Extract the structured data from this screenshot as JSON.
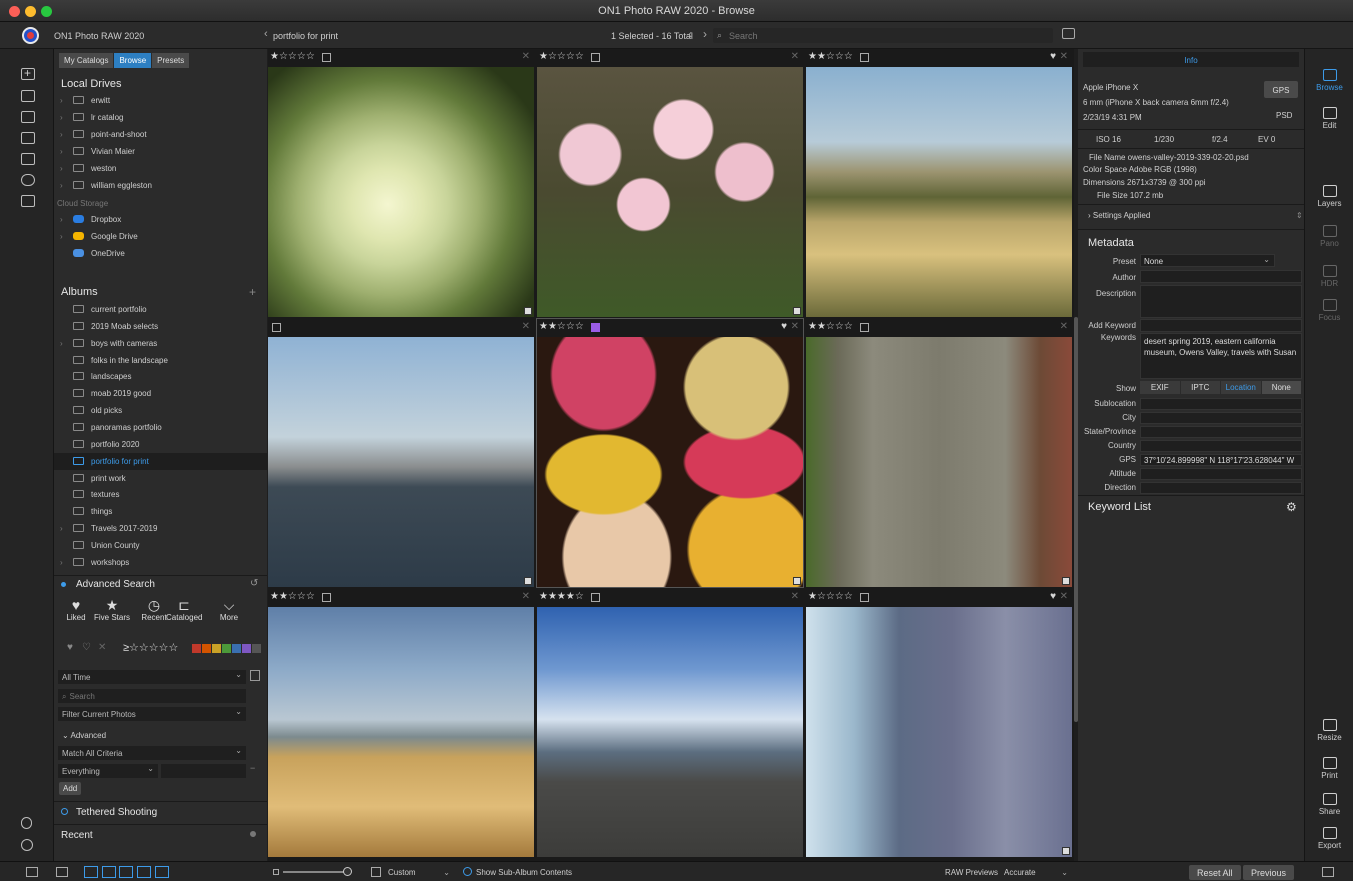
{
  "window": {
    "title": "ON1 Photo RAW 2020 - Browse"
  },
  "appbar": {
    "app_name": "ON1 Photo RAW 2020",
    "breadcrumb": "portfolio for print",
    "selection_info": "1 Selected - 16 Total",
    "search_placeholder": "Search"
  },
  "leftpanel": {
    "tabs": [
      "My Catalogs",
      "Browse",
      "Presets"
    ],
    "active_tab": "Browse",
    "local_drives_title": "Local Drives",
    "local_drives": [
      "erwitt",
      "lr catalog",
      "point-and-shoot",
      "Vivian Maier",
      "weston",
      "william eggleston"
    ],
    "cloud_title": "Cloud Storage",
    "cloud": [
      "Dropbox",
      "Google Drive",
      "OneDrive"
    ],
    "albums_title": "Albums",
    "albums": [
      "current portfolio",
      "2019 Moab selects",
      "boys with cameras",
      "folks in the landscape",
      "landscapes",
      "moab 2019 good",
      "old picks",
      "panoramas portfolio",
      "portfolio 2020",
      "portfolio for print",
      "print work",
      "textures",
      "things",
      "Travels 2017-2019",
      "Union County",
      "workshops"
    ],
    "selected_album": "portfolio for print",
    "advanced_search_title": "Advanced Search",
    "quick_filters": [
      "Liked",
      "Five Stars",
      "Recent",
      "Cataloged",
      "More"
    ],
    "time_filter": "All Time",
    "search_placeholder": "Search",
    "filter_scope": "Filter Current Photos",
    "advanced_label": "Advanced",
    "criteria": "Match All Criteria",
    "everything": "Everything",
    "add_label": "Add",
    "tethered_title": "Tethered Shooting",
    "recent_title": "Recent",
    "label_colors": [
      "#c0392b",
      "#d35400",
      "#c9a227",
      "#4c9a3a",
      "#3a6fb0",
      "#7e57c2",
      "#555555"
    ]
  },
  "grid": {
    "cells": [
      {
        "stars": "★☆☆☆☆",
        "subject": "white chrysanthemum",
        "liked": false
      },
      {
        "stars": "★☆☆☆☆",
        "subject": "pink tulips",
        "liked": false
      },
      {
        "stars": "★★☆☆☆",
        "subject": "grass field and hills",
        "liked": true
      },
      {
        "stars": "",
        "subject": "steel truss bridge",
        "liked": false
      },
      {
        "stars": "★★☆☆☆",
        "subject": "macarons",
        "liked": true
      },
      {
        "stars": "★★☆☆☆",
        "subject": "old wooden doors",
        "liked": false
      },
      {
        "stars": "★★☆☆☆",
        "subject": "irrigation wheel in wheat",
        "liked": false
      },
      {
        "stars": "★★★★☆",
        "subject": "highway and clouds",
        "liked": false
      },
      {
        "stars": "★☆☆☆☆",
        "subject": "cafe interior",
        "liked": true
      }
    ]
  },
  "info": {
    "header": "Info",
    "camera": "Apple iPhone X",
    "lens": "6 mm (iPhone X back camera 6mm f/2.4)",
    "date": "2/23/19 4:31 PM",
    "gps_button": "GPS",
    "format": "PSD",
    "iso": "ISO 16",
    "shutter": "1/230",
    "aperture": "f/2.4",
    "ev": "EV 0",
    "file_name": "File Name owens-valley-2019-339-02-20.psd",
    "color_space": "Color Space Adobe RGB (1998)",
    "dimensions": "Dimensions 2671x3739 @ 300 ppi",
    "file_size": "File Size 107.2 mb",
    "settings_applied": "Settings Applied"
  },
  "metadata": {
    "title": "Metadata",
    "preset_label": "Preset",
    "preset_value": "None",
    "author_label": "Author",
    "description_label": "Description",
    "add_keyword_label": "Add Keyword",
    "keywords_label": "Keywords",
    "keywords_value": "desert spring 2019, eastern california museum, Owens Valley, travels with Susan",
    "show_label": "Show",
    "show_tabs": [
      "EXIF",
      "IPTC",
      "Location",
      "None"
    ],
    "show_active": "Location",
    "fields": [
      "Sublocation",
      "City",
      "State/Province",
      "Country",
      "GPS",
      "Altitude",
      "Direction"
    ],
    "gps_value": "37°10'24.899998\" N 118°17'23.628044\" W",
    "keyword_list_title": "Keyword List"
  },
  "rightrail": {
    "top": [
      "Browse",
      "Edit",
      "Layers",
      "Pano",
      "HDR",
      "Focus"
    ],
    "bottom": [
      "Resize",
      "Print",
      "Share",
      "Export"
    ]
  },
  "bottombar": {
    "view_mode": "Custom",
    "show_sub_album": "Show Sub-Album Contents",
    "raw_previews_label": "RAW Previews",
    "raw_previews_value": "Accurate",
    "reset_all": "Reset All",
    "previous": "Previous"
  }
}
